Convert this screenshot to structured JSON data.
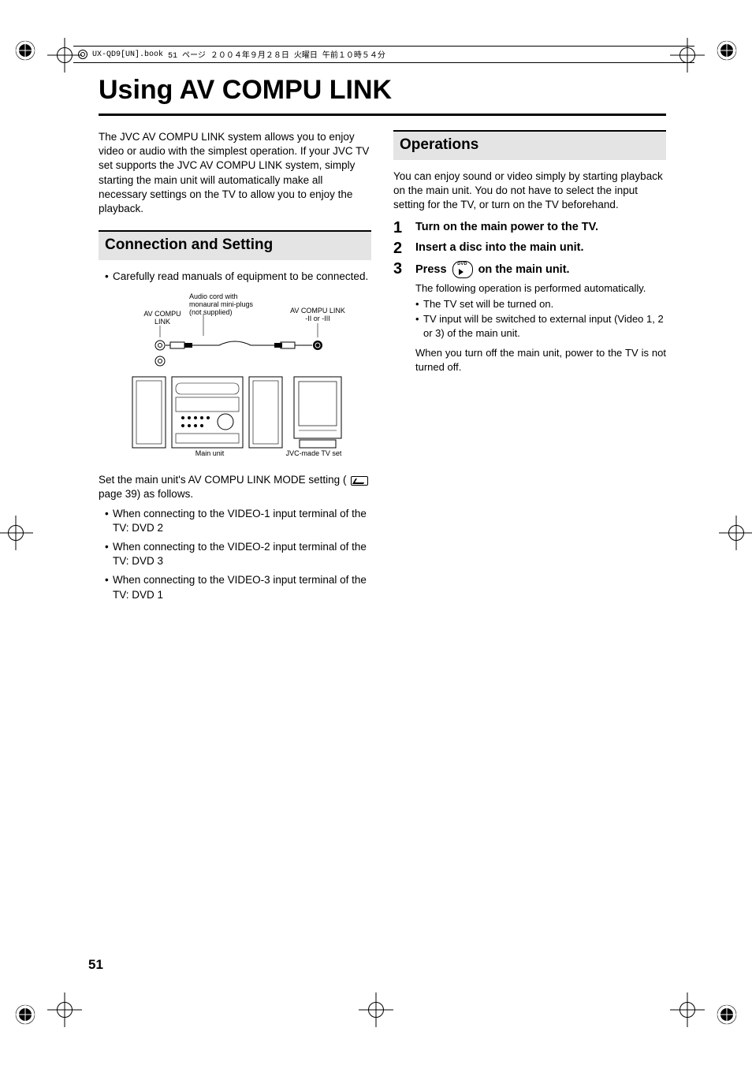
{
  "header": {
    "file": "UX-QD9[UN].book",
    "page_word": "51 ページ",
    "date": "２００４年９月２８日",
    "weekday": "火曜日",
    "time": "午前１０時５４分"
  },
  "title": "Using AV COMPU LINK",
  "intro": "The JVC AV COMPU LINK system allows you to enjoy video or audio with the simplest operation. If your JVC TV set supports the JVC AV COMPU LINK system, simply starting the main unit will automatically make all necessary settings on the TV to allow you to enjoy the playback.",
  "left": {
    "heading": "Connection and Setting",
    "bullet1": "Carefully read manuals of equipment to be connected.",
    "diag": {
      "cord": "Audio cord with monaural mini-plugs (not supplied)",
      "av_left": "AV COMPU LINK",
      "av_right": "AV COMPU LINK -II or -III",
      "main_unit": "Main unit",
      "tvset": "JVC-made TV set"
    },
    "post1a": "Set the main unit's AV COMPU LINK MODE setting (",
    "post1b": " page 39) as follows.",
    "b1": "When connecting to the VIDEO-1 input terminal of the TV: DVD 2",
    "b2": "When connecting to the VIDEO-2 input terminal of the TV: DVD 3",
    "b3": "When connecting to the VIDEO-3 input terminal of the TV: DVD 1"
  },
  "right": {
    "heading": "Operations",
    "intro": "You can enjoy sound or video simply by starting playback on the main unit. You do not have to select the input setting for the TV, or turn on the TV beforehand.",
    "steps": {
      "s1": "Turn on the main power to the TV.",
      "s2": "Insert a disc into the main unit.",
      "s3a": "Press ",
      "s3b": " on the main unit.",
      "s3_sub1": "The following operation is performed automatically.",
      "s3_b1": "The TV set will be turned on.",
      "s3_b2": "TV input will be switched to external input (Video 1, 2 or 3) of the main unit.",
      "s3_sub2": "When you turn off the main unit, power to the TV is not turned off."
    }
  },
  "page_number": "51"
}
